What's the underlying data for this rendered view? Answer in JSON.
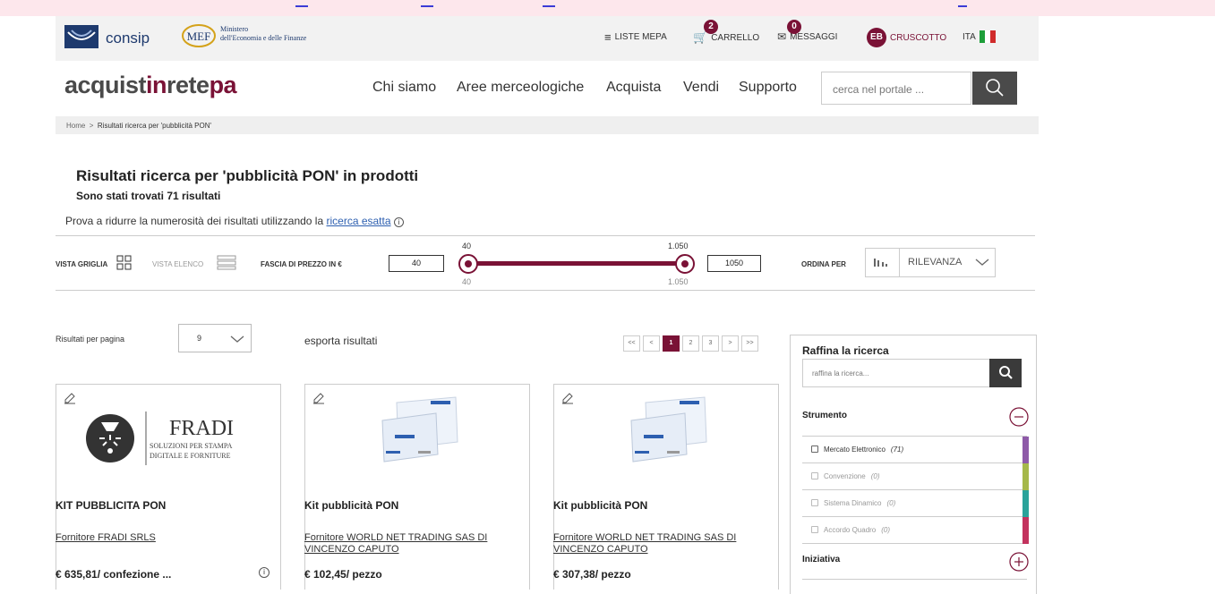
{
  "util": {
    "consip": "consip",
    "mef_line1": "Ministero",
    "mef_line2": "dell'Economia e delle Finanze",
    "liste": "LISTE MEPA",
    "carrello": "CARRELLO",
    "carrello_count": "2",
    "messaggi": "MESSAGGI",
    "messaggi_count": "0",
    "user_initials": "EB",
    "cruscotto": "CRUSCOTTO",
    "lang": "ITA",
    "brand_color": "#7a1236"
  },
  "brand": {
    "a": "acquist",
    "b": "in",
    "c": "rete",
    "d": "pa"
  },
  "nav": [
    "Chi siamo",
    "Aree merceologiche",
    "Acquista",
    "Vendi",
    "Supporto"
  ],
  "search": {
    "placeholder": "cerca nel portale ..."
  },
  "breadcrumb": {
    "home": "Home",
    "sep": ">",
    "current": "Risultati ricerca per 'pubblicità PON'"
  },
  "results": {
    "title": "Risultati ricerca per 'pubblicità PON' in prodotti",
    "count": "Sono stati trovati 71 risultati",
    "hint": "Prova a ridurre la numerosità dei risultati utilizzando la",
    "hint_link": "ricerca esatta"
  },
  "filter": {
    "grid": "VISTA GRIGLIA",
    "list": "VISTA ELENCO",
    "price_label": "FASCIA DI PREZZO IN €",
    "min": "40",
    "max": "1050",
    "min_tick": "40",
    "max_tick": "1.050",
    "sort_label": "ORDINA PER",
    "sort_value": "RILEVANZA"
  },
  "paging": {
    "rpp_label": "Risultati per pagina",
    "rpp_value": "9",
    "export": "esporta risultati",
    "pages": [
      "<<",
      "<",
      "1",
      "2",
      "3",
      ">",
      ">>"
    ],
    "current_page": "1"
  },
  "products": [
    {
      "title": "KIT PUBBLICITA PON",
      "supplier": "Fornitore FRADI SRLS",
      "price": "€ 635,81/ confezione ...",
      "logo_big": "FRADI",
      "logo_l1": "SOLUZIONI PER STAMPA",
      "logo_l2": "DIGITALE E FORNITURE"
    },
    {
      "title": "Kit pubblicità PON",
      "supplier": "Fornitore WORLD NET TRADING SAS DI VINCENZO CAPUTO",
      "price": "€ 102,45/ pezzo"
    },
    {
      "title": "Kit pubblicità PON",
      "supplier": "Fornitore WORLD NET TRADING SAS DI VINCENZO CAPUTO",
      "price": "€ 307,38/ pezzo"
    }
  ],
  "refine": {
    "title": "Raffina la ricerca",
    "placeholder": "raffina la ricerca...",
    "strumento": "Strumento",
    "options": [
      {
        "label": "Mercato Elettronico",
        "count": "(71)",
        "color": "#8e5aa8",
        "enabled": true
      },
      {
        "label": "Convenzione",
        "count": "(0)",
        "color": "#a5b84a",
        "enabled": false
      },
      {
        "label": "Sistema Dinamico",
        "count": "(0)",
        "color": "#2aa39a",
        "enabled": false
      },
      {
        "label": "Accordo Quadro",
        "count": "(0)",
        "color": "#c3335e",
        "enabled": false
      }
    ],
    "iniziativa": "Iniziativa"
  }
}
